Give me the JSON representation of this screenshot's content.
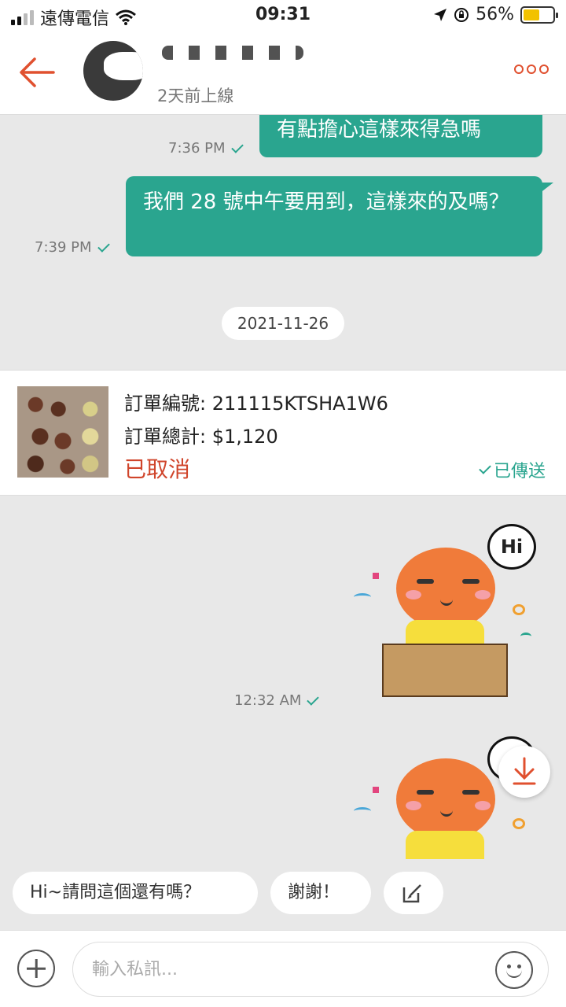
{
  "status_bar": {
    "carrier": "遠傳電信",
    "time": "09:31",
    "battery_percent": "56%",
    "battery_level": 0.56
  },
  "header": {
    "last_online": "2天前上線",
    "accent_color": "#e0502f"
  },
  "messages": [
    {
      "text": "有點擔心這樣來得急嗎",
      "time": "7:36 PM"
    },
    {
      "text": "我們 28 號中午要用到，這樣來的及嗎？",
      "time": "7:39 PM"
    }
  ],
  "date_separator": "2021-11-26",
  "order": {
    "number_label": "訂單編號:",
    "number": "211115KTSHA1W6",
    "total_label": "訂單總計:",
    "total": "$1,120",
    "status": "已取消",
    "sent_label": "已傳送"
  },
  "stickers": [
    {
      "bubble_text": "Hi",
      "time": "12:32 AM"
    },
    {
      "bubble_text": "!"
    }
  ],
  "quick_replies": [
    "Hi~請問這個還有嗎？",
    "謝謝！"
  ],
  "input": {
    "placeholder": "輸入私訊..."
  },
  "colors": {
    "bubble_green": "#2aa58f",
    "status_red": "#d0452b",
    "background": "#e8e8e8"
  }
}
